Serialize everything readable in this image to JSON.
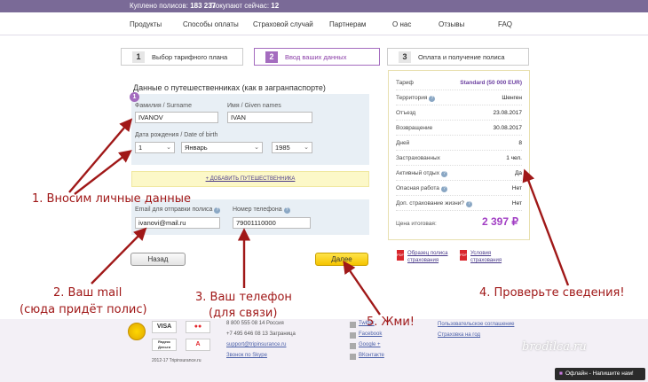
{
  "topbar": {
    "sold_label": "Куплено полисов:",
    "sold_value": "183 237",
    "now_label": "Покупают сейчас:",
    "now_value": "12"
  },
  "nav": [
    "Продукты",
    "Способы оплаты",
    "Страховой случай",
    "Партнерам",
    "О нас",
    "Отзывы",
    "FAQ"
  ],
  "steps": [
    {
      "num": "1",
      "label": "Выбор тарифного плана"
    },
    {
      "num": "2",
      "label": "Ввод ваших данных"
    },
    {
      "num": "3",
      "label": "Оплата и получение полиса"
    }
  ],
  "form": {
    "title": "Данные о путешественниках (как в загранпаспорте)",
    "badge": "1",
    "surname_label": "Фамилия / Surname",
    "surname_value": "IVANOV",
    "name_label": "Имя / Given names",
    "name_value": "IVAN",
    "dob_label": "Дата рождения / Date of birth",
    "dob_day": "1",
    "dob_month": "Январь",
    "dob_year": "1985",
    "add_traveler": "+ ДОБАВИТЬ ПУТЕШЕСТВЕННИКА",
    "email_label": "Email для отправки полиса",
    "email_value": "ivanovi@mail.ru",
    "phone_label": "Номер телефона",
    "phone_value": "79001110000",
    "back_button": "Назад",
    "next_button": "Далее"
  },
  "summary": {
    "rows": [
      {
        "key": "Тариф",
        "value": "Standard (50 000 EUR)"
      },
      {
        "key": "Территория",
        "value": "Шенген"
      },
      {
        "key": "Отъезд",
        "value": "23.08.2017"
      },
      {
        "key": "Возвращение",
        "value": "30.08.2017"
      },
      {
        "key": "Дней",
        "value": "8"
      },
      {
        "key": "Застрахованных",
        "value": "1 чел."
      },
      {
        "key": "Активный отдых",
        "value": "Да"
      },
      {
        "key": "Опасная работа",
        "value": "Нет"
      },
      {
        "key": "Доп. страхование жизни?",
        "value": "Нет"
      }
    ],
    "total_label": "Цена итоговая:",
    "total_value": "2 397 ₽",
    "doc1": "Образец полиса страхования",
    "doc2": "Условия страхования"
  },
  "footer": {
    "visa": "VISA",
    "mc": "MC",
    "yandex": "Яндекс Деньги",
    "alfa": "А",
    "copyright": "2012-17 Tripinsurance.ru",
    "phone1": "8 800 555 08 14 Россия",
    "phone2": "+7 495 646 08 13 Заграница",
    "support_email": "support@tripinsurance.ru",
    "skype": "Звонок по Skype",
    "social": [
      "Twitter",
      "Facebook",
      "Google +",
      "ВКонтакте"
    ],
    "agreement": "Пользовательское соглашение",
    "year_insurance": "Страховка на год",
    "brand": "brodilca.ru",
    "chat": "Офлайн - Напишите нам!"
  },
  "annotations": {
    "a1": "1. Вносим личные данные",
    "a2_line1": "2. Ваш mail",
    "a2_line2": "(сюда придёт полис)",
    "a3_line1": "3. Ваш телефон",
    "a3_line2": "(для связи)",
    "a4": "4. Проверьте сведения!",
    "a5": "5. Жми!"
  },
  "colors": {
    "purple": "#7a6a97",
    "accent": "#a46cbf",
    "annotation": "#a01818",
    "next_button": "#f5c400"
  }
}
